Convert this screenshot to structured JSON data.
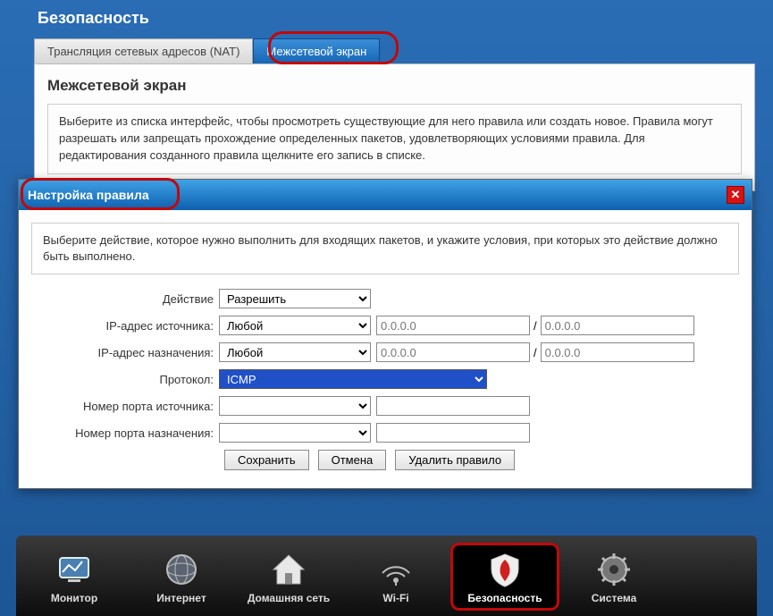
{
  "page_title": "Безопасность",
  "tabs": {
    "nat": "Трансляция сетевых адресов (NAT)",
    "firewall": "Межсетевой экран"
  },
  "section": {
    "title": "Межсетевой экран",
    "desc": "Выберите из списка интерфейс, чтобы просмотреть существующие для него правила или создать новое. Правила могут разрешать или запрещать прохождение определенных пакетов, удовлетворяющих условиями правила. Для редактирования созданного правила щелкните его запись в списке."
  },
  "dialog": {
    "title": "Настройка правила",
    "desc": "Выберите действие, которое нужно выполнить для входящих пакетов, и укажите условия, при которых это действие должно быть выполнено.",
    "labels": {
      "action": "Действие",
      "src_ip": "IP-адрес источника:",
      "dst_ip": "IP-адрес назначения:",
      "proto": "Протокол:",
      "src_port": "Номер порта источника:",
      "dst_port": "Номер порта назначения:"
    },
    "values": {
      "action": "Разрешить",
      "src_mode": "Любой",
      "dst_mode": "Любой",
      "proto": "ICMP",
      "ip_placeholder": "0.0.0.0"
    },
    "buttons": {
      "save": "Сохранить",
      "cancel": "Отмена",
      "delete": "Удалить правило"
    }
  },
  "nav": {
    "monitor": "Монитор",
    "internet": "Интернет",
    "home": "Домашняя сеть",
    "wifi": "Wi-Fi",
    "security": "Безопасность",
    "system": "Система"
  }
}
